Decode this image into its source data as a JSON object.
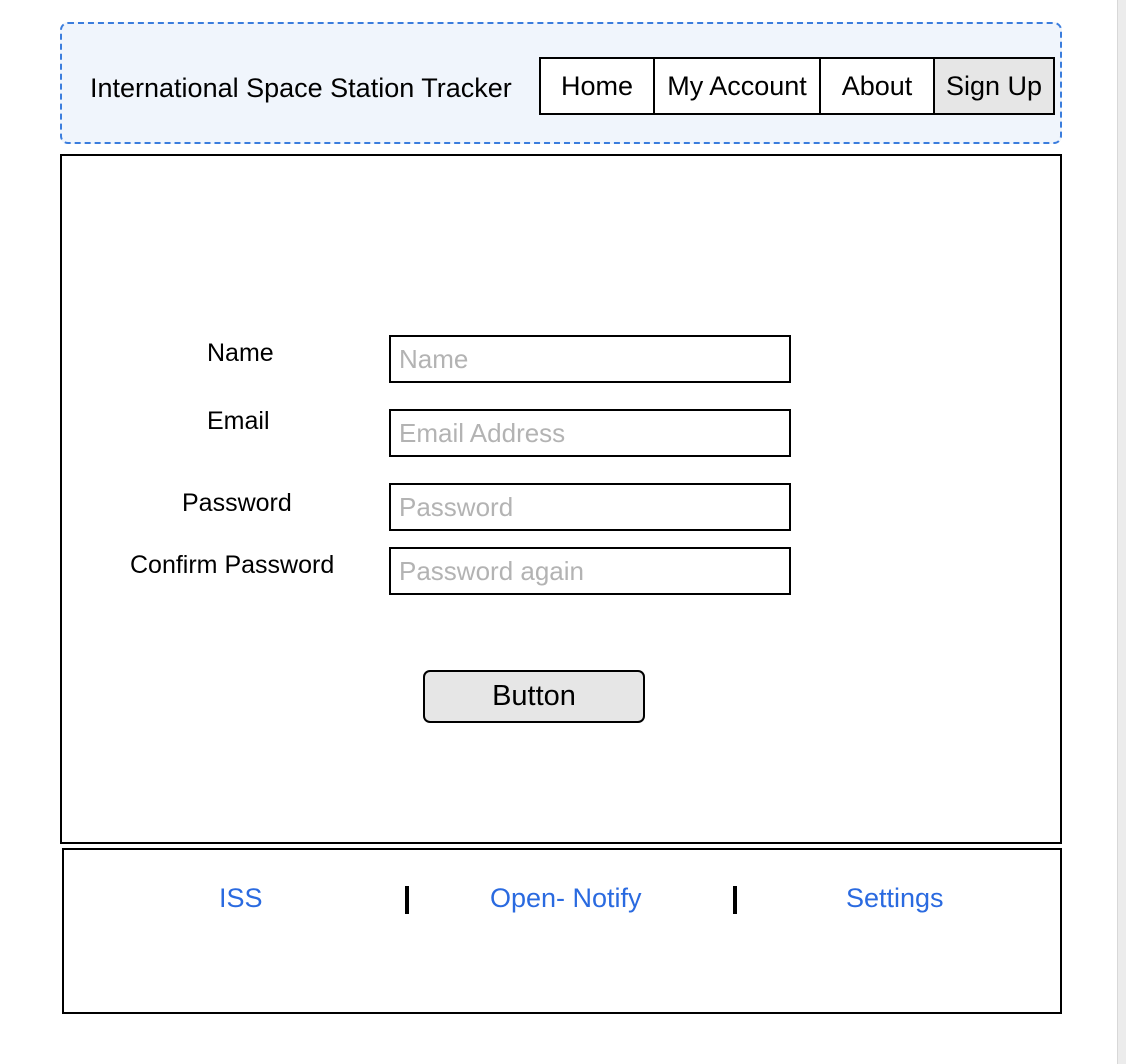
{
  "header": {
    "title": "International Space Station Tracker",
    "nav": {
      "home": "Home",
      "my_account": "My Account",
      "about": "About",
      "sign_up": "Sign Up",
      "active": "Sign Up"
    }
  },
  "form": {
    "name": {
      "label": "Name",
      "placeholder": "Name",
      "value": ""
    },
    "email": {
      "label": "Email",
      "placeholder": "Email Address",
      "value": ""
    },
    "password": {
      "label": "Password",
      "placeholder": "Password",
      "value": ""
    },
    "confirm_password": {
      "label": "Confirm Password",
      "placeholder": "Password again",
      "value": ""
    },
    "submit_label": "Button"
  },
  "footer": {
    "links": {
      "iss": "ISS",
      "open_notify": "Open- Notify",
      "settings": "Settings"
    }
  },
  "colors": {
    "link": "#2a6ae0",
    "header_border": "#3b7ddd",
    "header_bg": "#f0f5fc",
    "active_nav_bg": "#e6e6e6"
  }
}
